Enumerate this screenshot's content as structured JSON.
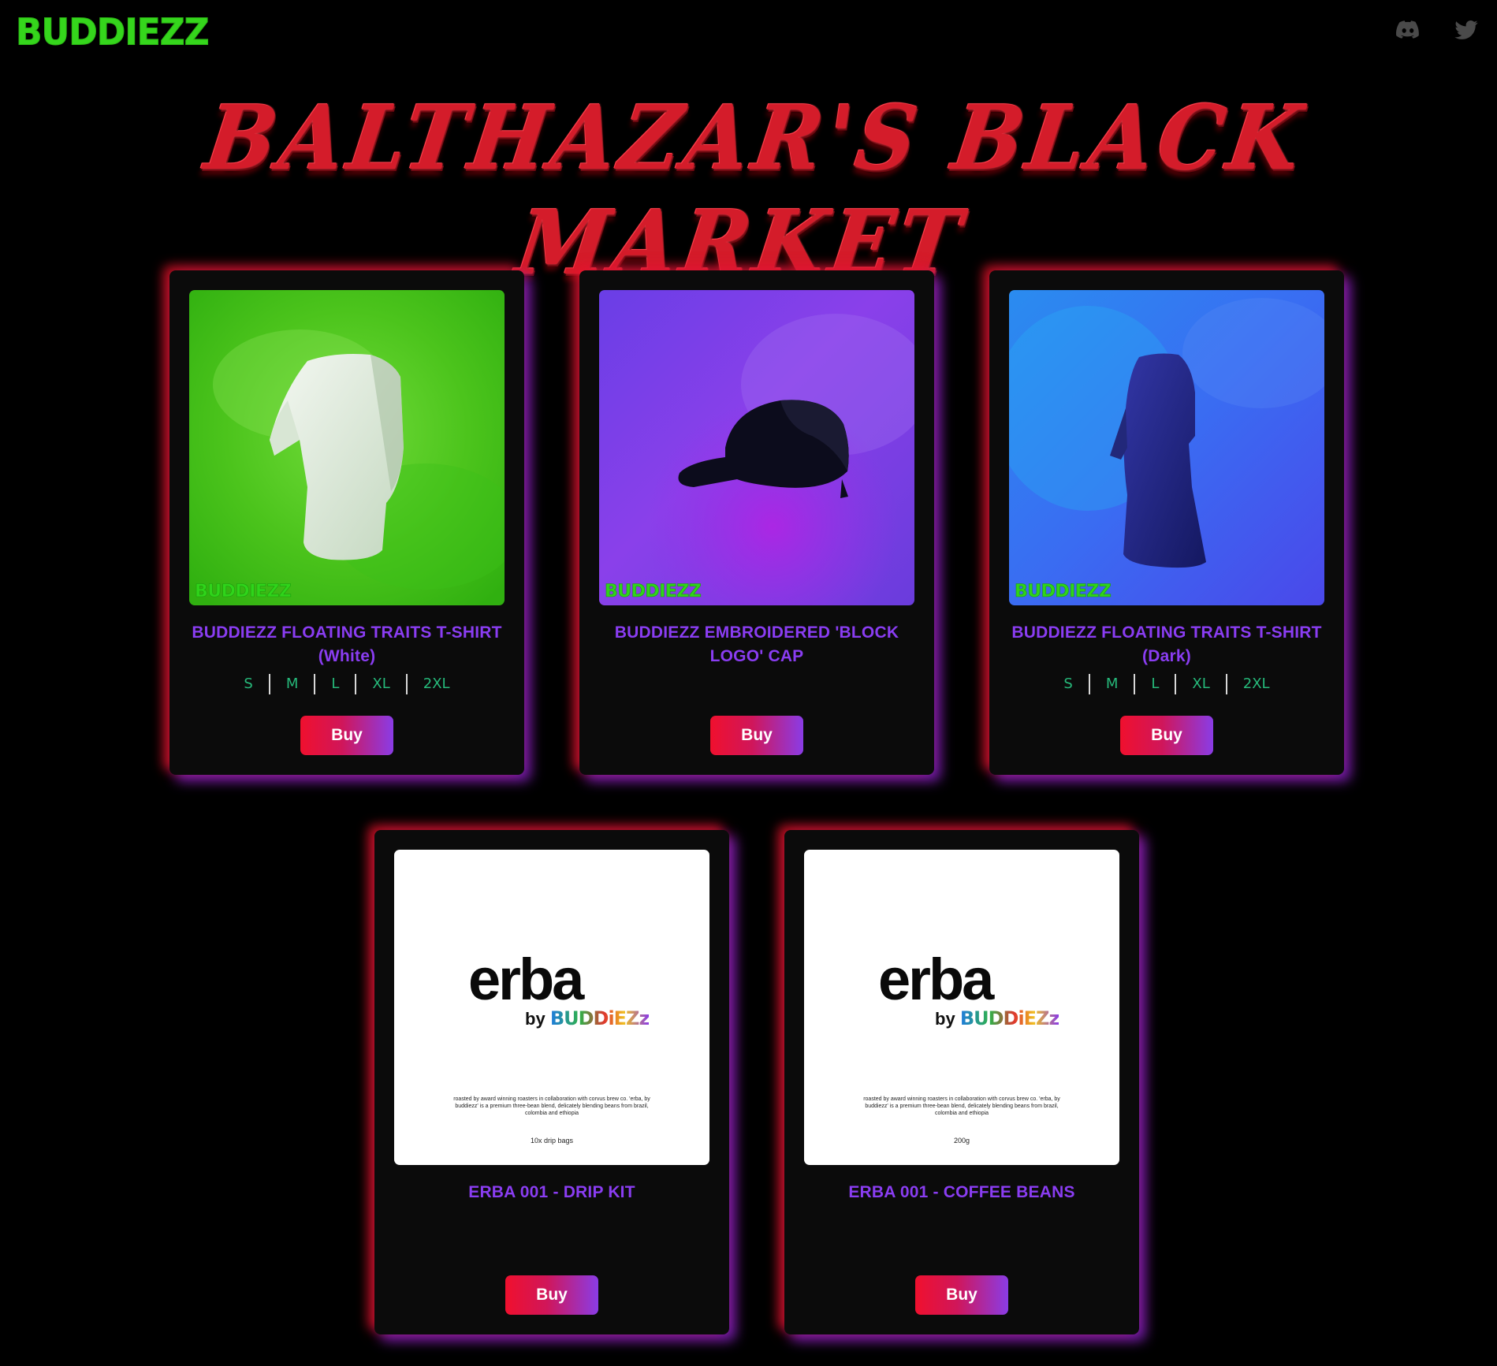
{
  "header": {
    "brand": "BUDDIEZZ",
    "social": [
      {
        "name": "discord",
        "icon": "discord-icon"
      },
      {
        "name": "twitter",
        "icon": "twitter-icon"
      }
    ]
  },
  "hero": {
    "title": "BALTHAZAR'S BLACK MARKET"
  },
  "colors": {
    "background": "#000000",
    "brand_green": "#35d61c",
    "title_red": "#d41c2a",
    "product_title": "#8a3df2",
    "size_text": "#26b97a",
    "button_gradient_start": "#f0102e",
    "button_gradient_end": "#8a3ce6"
  },
  "products": [
    {
      "title": "BUDDIEZZ FLOATING TRAITS T-SHIRT (White)",
      "image": "white-tshirt-on-green",
      "watermark": "BUDDIEZZ",
      "sizes": [
        "S",
        "M",
        "L",
        "XL",
        "2XL"
      ],
      "button": "Buy"
    },
    {
      "title": "BUDDIEZZ EMBROIDERED 'BLOCK LOGO' CAP",
      "image": "black-cap-on-purple",
      "watermark": "BUDDIEZZ",
      "sizes": [],
      "button": "Buy"
    },
    {
      "title": "BUDDIEZZ FLOATING TRAITS T-SHIRT (Dark)",
      "image": "dark-tshirt-on-blue",
      "watermark": "BUDDIEZZ",
      "sizes": [
        "S",
        "M",
        "L",
        "XL",
        "2XL"
      ],
      "button": "Buy"
    },
    {
      "title": "ERBA 001 - DRIP KIT",
      "image": "erba-package",
      "erba_word": "erba",
      "erba_by": "by",
      "erba_brand": "BUDDiEZz",
      "erba_desc": "roasted by award winning roasters in collaboration with corvus brew co. 'erba, by buddiezz' is a premium three-bean blend, delicately blending beans from brazil, colombia and ethiopia",
      "erba_qty": "10x drip bags",
      "button": "Buy"
    },
    {
      "title": "ERBA 001 - COFFEE BEANS",
      "image": "erba-package",
      "erba_word": "erba",
      "erba_by": "by",
      "erba_brand": "BUDDiEZz",
      "erba_desc": "roasted by award winning roasters in collaboration with corvus brew co. 'erba, by buddiezz' is a premium three-bean blend, delicately blending beans from brazil, colombia and ethiopia",
      "erba_qty": "200g",
      "button": "Buy"
    }
  ]
}
